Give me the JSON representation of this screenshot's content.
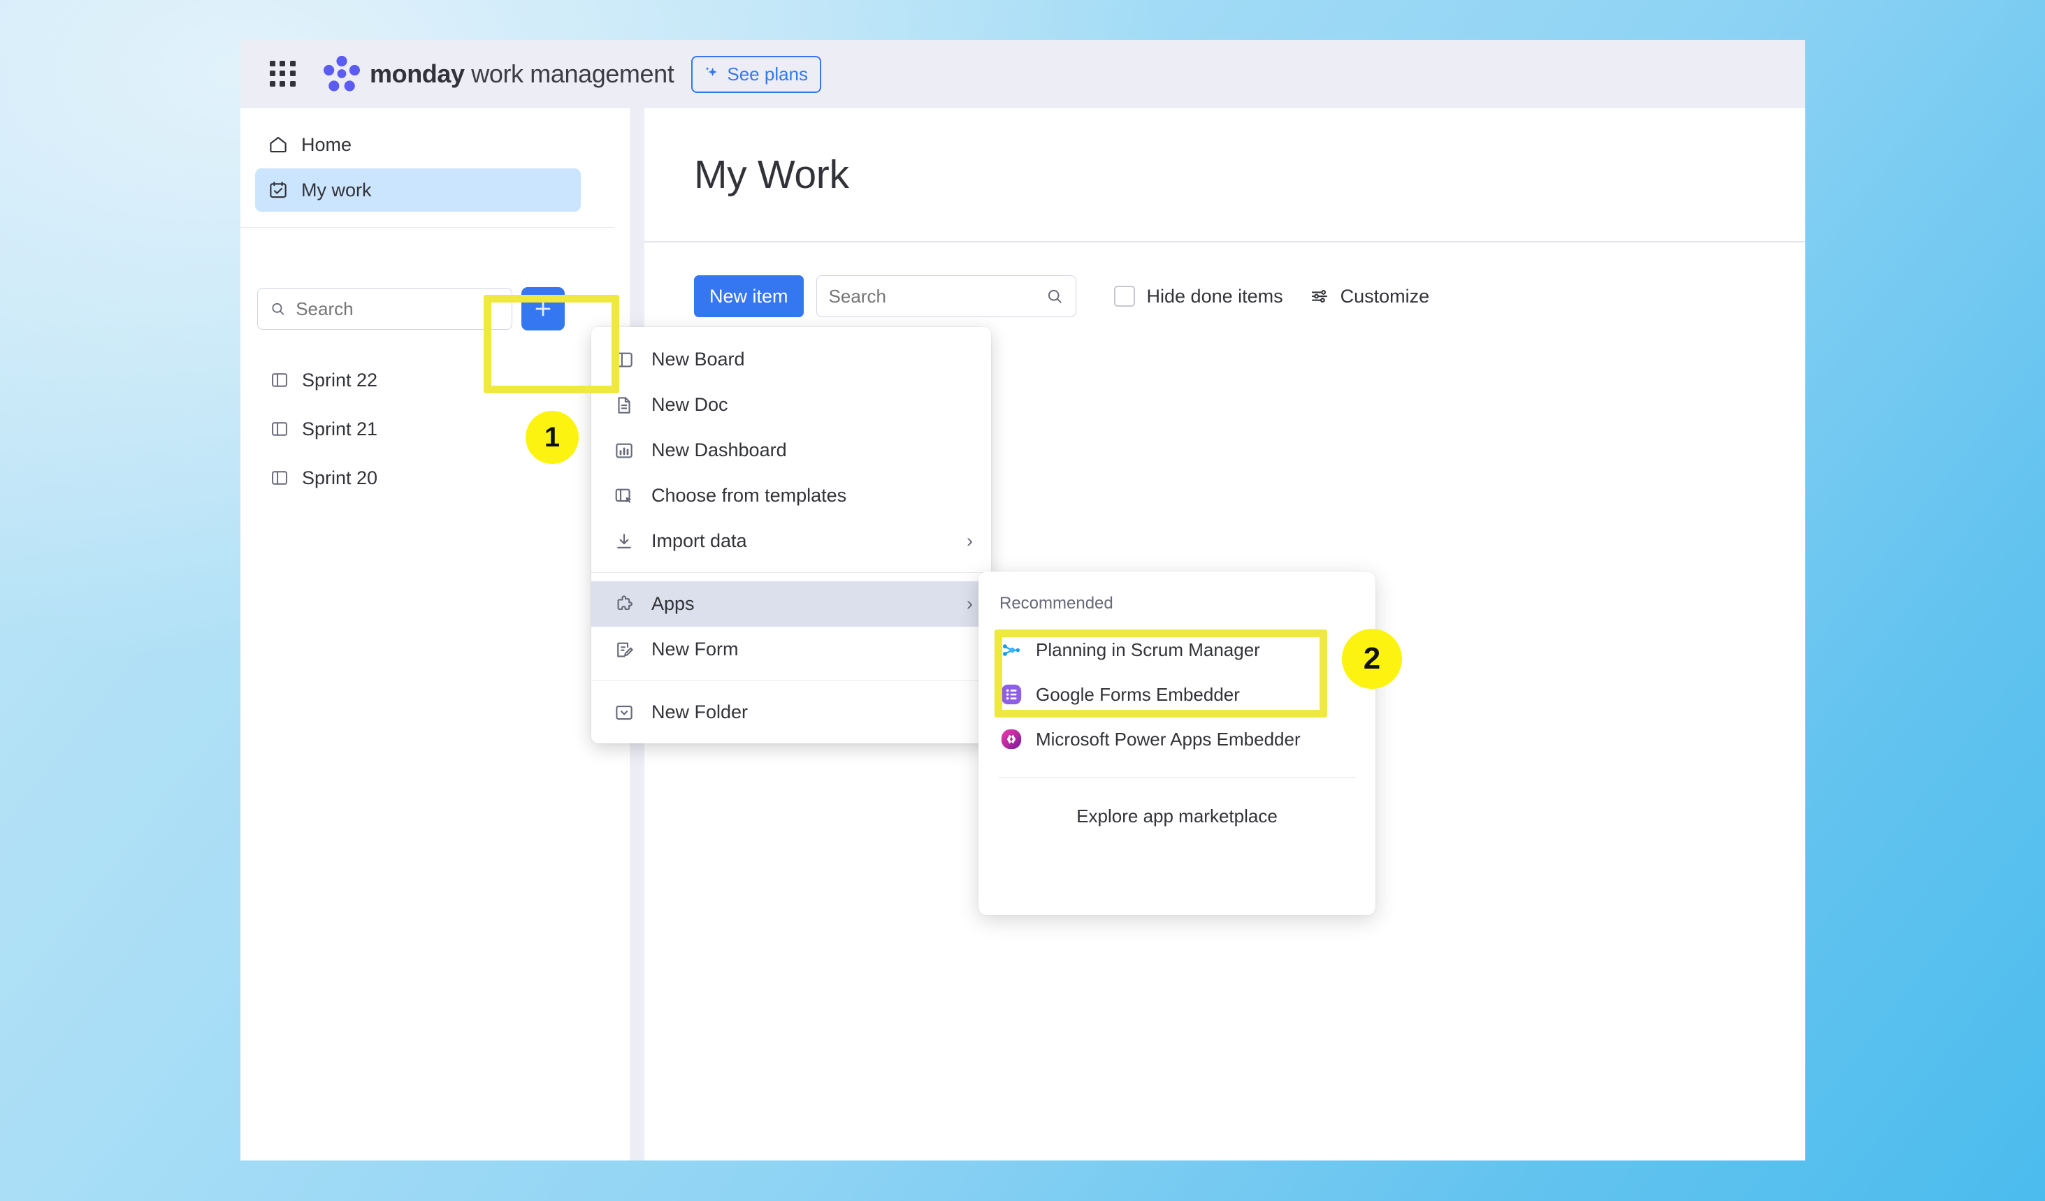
{
  "topbar": {
    "waffle_icon": "apps-grid-icon",
    "logo_icon": "monday-logo-icon",
    "brand_bold": "monday",
    "brand_rest": " work management",
    "see_plans_label": "See plans",
    "see_plans_icon": "sparkle-icon",
    "accent_blue": "#3577f0",
    "bar_bg": "#edeef5"
  },
  "sidebar": {
    "nav": [
      {
        "label": "Home",
        "icon": "home-icon",
        "active": false
      },
      {
        "label": "My work",
        "icon": "my-work-calendar-icon",
        "active": true
      }
    ],
    "search": {
      "placeholder": "Search",
      "value": "",
      "icon": "search-icon"
    },
    "add_button": {
      "label": "+",
      "icon": "plus-icon"
    },
    "boards": [
      {
        "label": "Sprint 22",
        "icon": "board-icon"
      },
      {
        "label": "Sprint 21",
        "icon": "board-icon"
      },
      {
        "label": "Sprint 20",
        "icon": "board-icon"
      }
    ]
  },
  "main": {
    "title": "My Work",
    "toolbar": {
      "new_item_label": "New item",
      "search_placeholder": "Search",
      "search_value": "",
      "search_icon": "search-icon",
      "hide_done_label": "Hide done items",
      "hide_done_checked": false,
      "customize_label": "Customize",
      "customize_icon": "sliders-icon"
    }
  },
  "context_menu": {
    "items": [
      {
        "label": "New Board",
        "icon": "board-icon",
        "submenu": false,
        "highlight": false
      },
      {
        "label": "New Doc",
        "icon": "doc-icon",
        "submenu": false,
        "highlight": false
      },
      {
        "label": "New Dashboard",
        "icon": "dashboard-icon",
        "submenu": false,
        "highlight": false
      },
      {
        "label": "Choose from templates",
        "icon": "templates-icon",
        "submenu": false,
        "highlight": false
      },
      {
        "label": "Import data",
        "icon": "import-icon",
        "submenu": true,
        "highlight": false
      }
    ],
    "items2": [
      {
        "label": "Apps",
        "icon": "puzzle-icon",
        "submenu": true,
        "highlight": true
      },
      {
        "label": "New Form",
        "icon": "form-icon",
        "submenu": false,
        "highlight": false
      }
    ],
    "items3": [
      {
        "label": "New Folder",
        "icon": "folder-icon",
        "submenu": false,
        "highlight": false
      }
    ],
    "chevron": "›"
  },
  "apps_submenu": {
    "heading": "Recommended",
    "apps": [
      {
        "label": "Planning in Scrum Manager",
        "icon": "scrum-graph-icon"
      },
      {
        "label": "Google Forms Embedder",
        "icon": "google-forms-icon"
      },
      {
        "label": "Microsoft Power Apps Embedder",
        "icon": "power-apps-icon"
      }
    ],
    "explore_label": "Explore app marketplace"
  },
  "annotations": {
    "step1": "1",
    "step2": "2",
    "highlight_color": "#efe93f",
    "badge_color": "#fcf410"
  }
}
